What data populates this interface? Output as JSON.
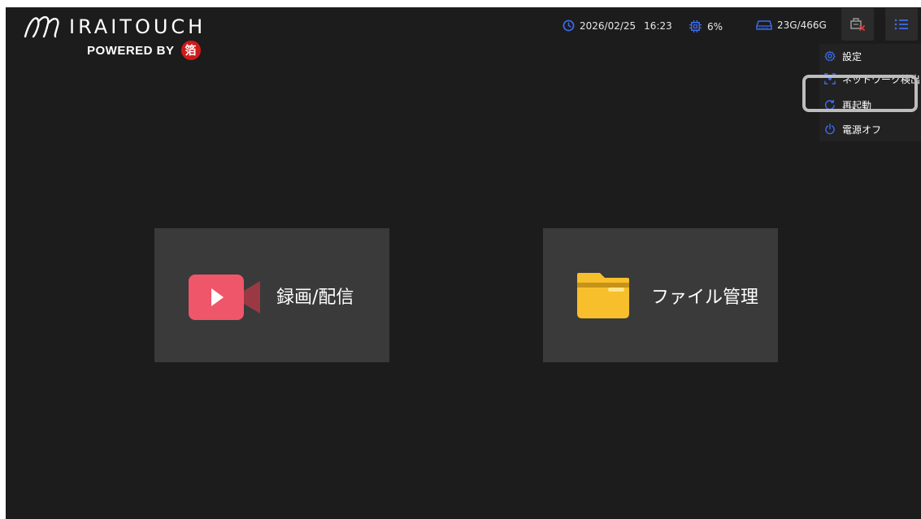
{
  "brand": {
    "name": "IRAITOUCH",
    "powered_by": "POWERED BY",
    "seal_glyph": "箔"
  },
  "status_bar": {
    "date": "2026/02/25",
    "time": "16:23",
    "cpu": "6%",
    "storage": "23G/466G"
  },
  "colors": {
    "accent": "#3d6cf0",
    "background": "#1c1c1c",
    "card": "#3a3a3a",
    "video_icon": "#f0566a",
    "folder_icon": "#f7bf2b"
  },
  "menu": {
    "items": [
      {
        "label": "設定",
        "icon": "gear-icon"
      },
      {
        "label": "ネットワーク検出",
        "icon": "network-scan-icon"
      },
      {
        "label": "再起動",
        "icon": "restart-icon"
      },
      {
        "label": "電源オフ",
        "icon": "power-icon"
      }
    ]
  },
  "cards": {
    "record": {
      "label": "録画/配信",
      "icon": "video-camera-icon"
    },
    "files": {
      "label": "ファイル管理",
      "icon": "folder-icon"
    }
  }
}
